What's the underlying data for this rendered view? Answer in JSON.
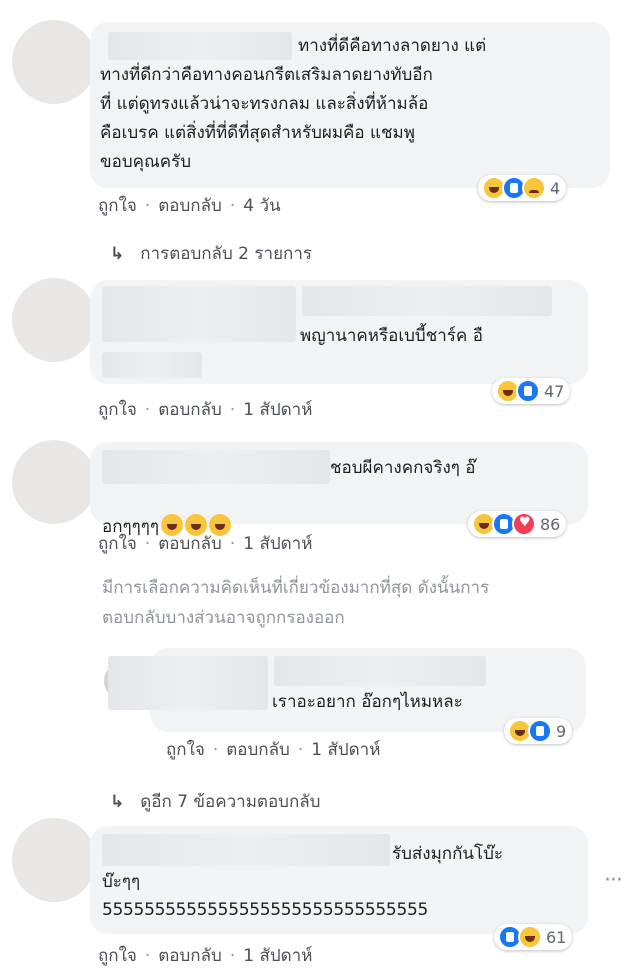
{
  "comments": [
    {
      "text": "ทางที่ดีคือทางลาดยาง แต่\nทางที่ดีกว่าคือทางคอนกรีตเสริมลาดยางทับอีก\nที่ แต่ดูทรงแล้วน่าจะทรงกลม และสิ่งที่ห้ามล้อ\nคือเบรค แต่สิ่งที่ที่ดีที่สุดสำหรับผมคือ แชมพู\nขอบคุณครับ",
      "like": "ถูกใจ",
      "reply": "ตอบกลับ",
      "time": "4 วัน",
      "reactions": [
        "haha",
        "like",
        "sad"
      ],
      "count": "4"
    },
    {
      "text": "พญานาคหรือเบบี้ชาร์ค อื",
      "like": "ถูกใจ",
      "reply": "ตอบกลับ",
      "time": "1 สัปดาห์",
      "reactions": [
        "haha",
        "like"
      ],
      "count": "47"
    },
    {
      "text_line1": "ชอบผีคางคกจริงๆ อ๊",
      "text_line2": "อกๆๆๆๆ",
      "like": "ถูกใจ",
      "reply": "ตอบกลับ",
      "time": "1 สัปดาห์",
      "reactions": [
        "haha",
        "like",
        "love"
      ],
      "count": "86"
    },
    {
      "text": "เราอะอยาก อ๊อกๆไหมหละ",
      "like": "ถูกใจ",
      "reply": "ตอบกลับ",
      "time": "1 สัปดาห์",
      "reactions": [
        "haha",
        "like"
      ],
      "count": "9"
    },
    {
      "text_line1": "รับส่งมุกกันโบ๊ะ",
      "text_line2": "บ๊ะๆๆ",
      "text_line3": "5555555555555555555555555555555",
      "like": "ถูกใจ",
      "reply": "ตอบกลับ",
      "time": "1 สัปดาห์",
      "reactions": [
        "like",
        "haha"
      ],
      "count": "61"
    }
  ],
  "replies_link": "การตอบกลับ 2 รายการ",
  "more_replies_link": "ดูอีก 7 ข้อความตอบกลับ",
  "filter_notice": "มีการเลือกความคิดเห็นที่เกี่ยวข้องมากที่สุด ดังนั้นการ\nตอบกลับบางส่วนอาจถูกกรองออก",
  "dot": "·",
  "arrow_glyph": "↳",
  "colors": {
    "like_blue": "#1877f2",
    "bubble_gray": "#f2f3f5",
    "meta_gray": "#90949c"
  }
}
